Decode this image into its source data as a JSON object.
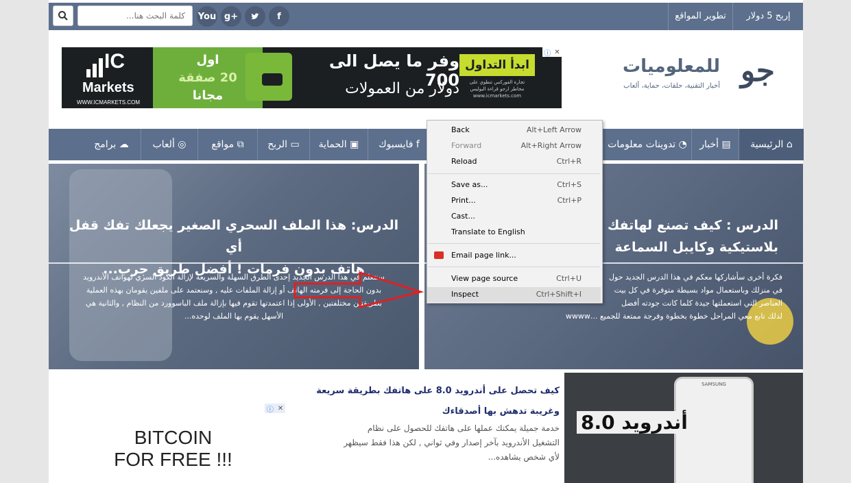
{
  "topbar": {
    "earn_link": "إربح 5 دولار",
    "dev_link": "تطوير المواقع",
    "search_placeholder": "كلمة البحث هنا...",
    "social": [
      {
        "label": "f",
        "icon": "facebook-icon"
      },
      {
        "label": "t",
        "icon": "twitter-icon"
      },
      {
        "label": "g+",
        "icon": "googleplus-icon"
      },
      {
        "label": "You",
        "icon": "youtube-icon"
      }
    ]
  },
  "logo": {
    "title": "للمعلوميات",
    "tagline": "أخبار التقنية، حلقات، حماية، ألعاب",
    "mark": "جو"
  },
  "ad_banner": {
    "cta": "ابدأ التداول",
    "line1": "وفر ما يصل الى 700",
    "line2": "دولار من العمولات",
    "small1": "تجارة الفوركس تنطوي على",
    "small2": "مخاطر ارجو قراءة البوليس",
    "url": "www.icmarkets.com",
    "offer1": "اول",
    "offer2": "20 صفقة",
    "offer3": "مجانا",
    "brand": "IC",
    "brand2": "Markets",
    "brand_url": "WWW.ICMARKETS.COM"
  },
  "nav": {
    "items": [
      {
        "label": "الرئيسية",
        "icon": "home-icon"
      },
      {
        "label": "أخبار",
        "icon": "newspaper-icon"
      },
      {
        "label": "تدوينات معلومات",
        "icon": "rss-icon"
      },
      {
        "label": "فايسبوك",
        "icon": "facebook-icon"
      },
      {
        "label": "الحماية",
        "icon": "lock-icon"
      },
      {
        "label": "الربح",
        "icon": "money-icon"
      },
      {
        "label": "مواقع",
        "icon": "external-link-icon"
      },
      {
        "label": "ألعاب",
        "icon": "gamepad-icon"
      },
      {
        "label": "برامج",
        "icon": "cloud-icon"
      }
    ]
  },
  "featured": [
    {
      "title_l1": "الدرس : كيف تصنع لهاتفك مكبر",
      "title_l2": "بلاستيكية وكايبل السماعة",
      "excerpt_l1": "فكرة أخرى سأشاركها معكم في هذا الدرس الجديد حول",
      "excerpt_l2": "في منزلك وباستعمال مواد بسيطة متوفرة في كل بيت",
      "excerpt_l3": "العناصر التي استعملتها جيدة كلما كانت جودته أفضل",
      "excerpt_l4": "لذلك تابع معي المراحل خطوة بخطوة وفرجة ممتعة للجميع ...wwww"
    },
    {
      "title_l1": "الدرس: هذا الملف السحري الصغير يجعلك تفك قفل أي",
      "title_l2": "هاتف بدون فرمات ! أفضل طريق جرب...",
      "excerpt_l1": "سنتعلم في هذا الدرس الجديد إحدى الطرق السهلة والسريعة لإزالة الكود السري لهواتف الأندرويد",
      "excerpt_l2": "بدون الحاجة إلى فرمته الهاتف أو إزالة الملفات عليه , وسنعتمد على ملفين يقومان بهذه العملية",
      "excerpt_l3": "بطريقتين مختلفتين , الأولى إذا اعتمدتها تقوم فيها بإزالة ملف الباسوورد من النظام , والثانية هي",
      "excerpt_l4": "الأسهل يقوم بها الملف لوحده..."
    }
  ],
  "ad_small": {
    "line1": "BITCOIN",
    "line2": "FOR FREE !!!"
  },
  "post": {
    "title_l1": "كيف تحصل على أندرويد 8.0 على هاتفك بطريقة سريعة",
    "title_l2": "وغريبة تدهش بها أصدقاءك",
    "excerpt_l1": "خدمة جميلة يمكنك عملها على هاتفك للحصول على نظام",
    "excerpt_l2": "التشغيل الأندرويد بآخر إصدار وفي ثواني , لكن هذا فقط سيظهر",
    "excerpt_l3": "لأي شخص يشاهده...",
    "thumb_label": "أندرويد 8.0",
    "phone_brand": "SAMSUNG"
  },
  "context_menu": {
    "items": [
      {
        "label": "Back",
        "shortcut": "Alt+Left Arrow"
      },
      {
        "label": "Forward",
        "shortcut": "Alt+Right Arrow"
      },
      {
        "label": "Reload",
        "shortcut": "Ctrl+R"
      },
      {
        "label": "Save as...",
        "shortcut": "Ctrl+S"
      },
      {
        "label": "Print...",
        "shortcut": "Ctrl+P"
      },
      {
        "label": "Cast...",
        "shortcut": ""
      },
      {
        "label": "Translate to English",
        "shortcut": ""
      },
      {
        "label": "Email page link...",
        "shortcut": ""
      },
      {
        "label": "View page source",
        "shortcut": "Ctrl+U"
      },
      {
        "label": "Inspect",
        "shortcut": "Ctrl+Shift+I"
      }
    ]
  },
  "colors": {
    "header_blue": "#5c6f8c",
    "arrow_red": "#e02020",
    "title_navy": "#1f2d6e"
  }
}
